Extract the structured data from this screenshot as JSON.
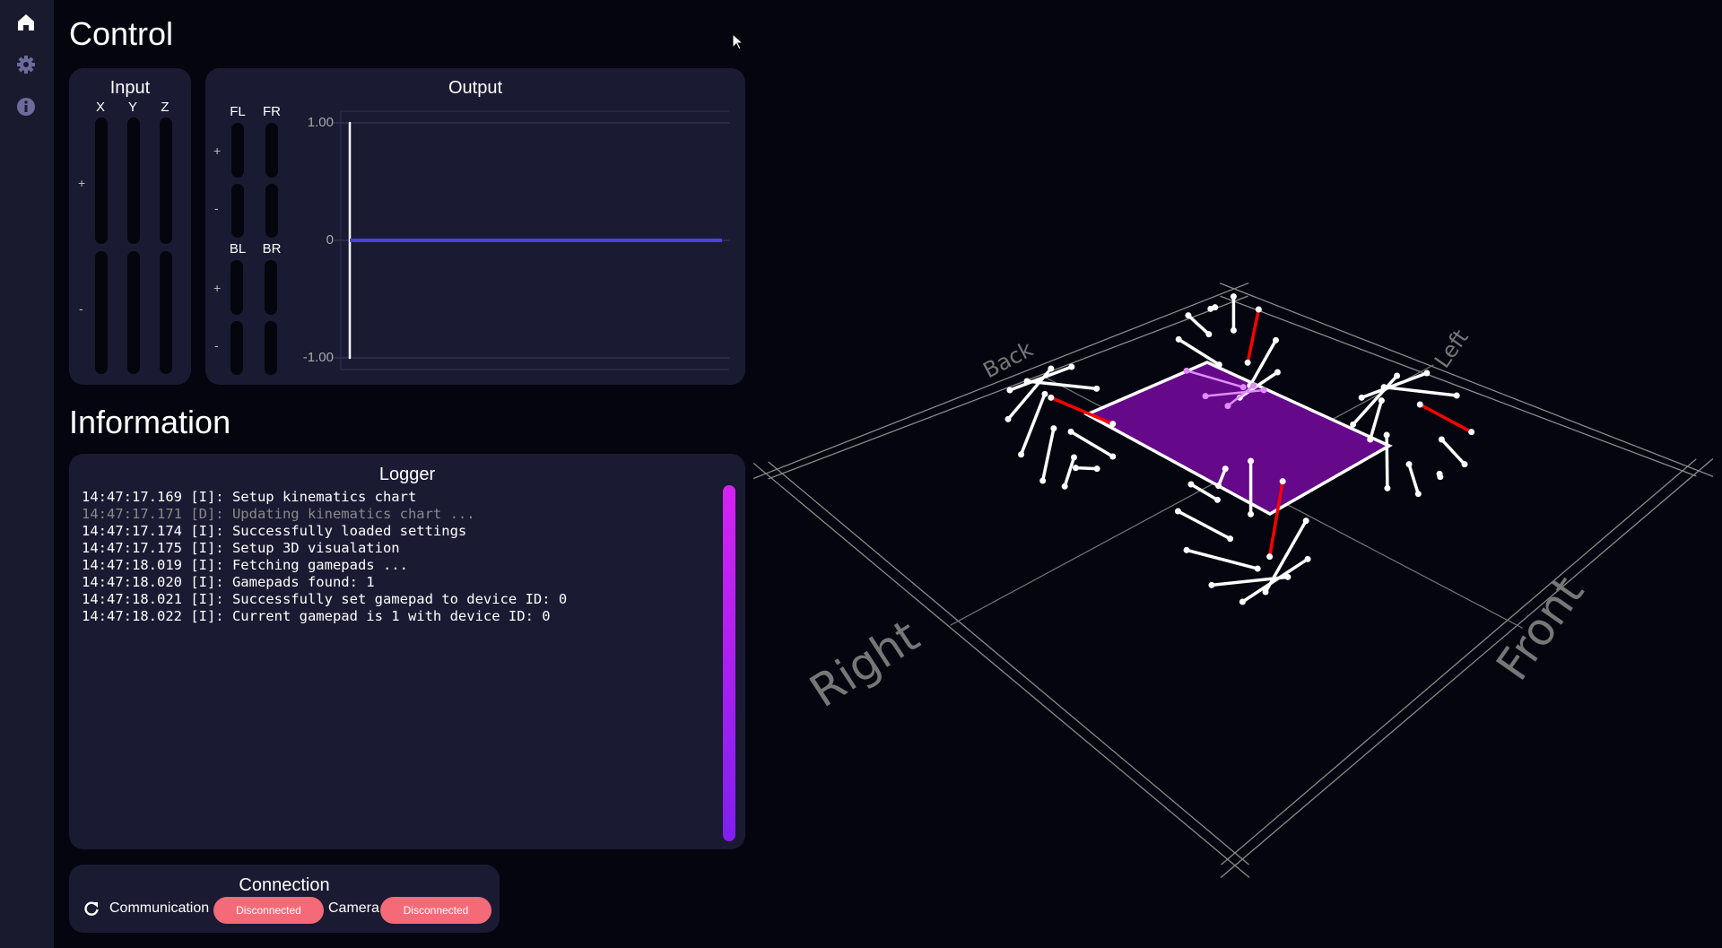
{
  "sidebar": {
    "items": [
      {
        "icon": "home-icon",
        "active": true
      },
      {
        "icon": "gear-icon",
        "active": false
      },
      {
        "icon": "info-icon",
        "active": false
      }
    ]
  },
  "control": {
    "title": "Control",
    "input": {
      "title": "Input",
      "axes": [
        "X",
        "Y",
        "Z"
      ],
      "plus": "+",
      "minus": "-"
    },
    "output": {
      "title": "Output",
      "wheels": [
        "FL",
        "FR",
        "BL",
        "BR"
      ],
      "plus": "+",
      "minus": "-"
    }
  },
  "chart_data": {
    "type": "line",
    "title": "",
    "ylim": [
      -1,
      1
    ],
    "yticks": [
      "1.00",
      "0",
      "-1.00"
    ],
    "grid": true,
    "series": [
      {
        "values": [
          0,
          0
        ],
        "color": "#4b3ff0"
      }
    ],
    "marker_line": {
      "color": "#ffffff",
      "range": [
        -1,
        1
      ]
    }
  },
  "information": {
    "title": "Information",
    "logger": {
      "title": "Logger",
      "lines": [
        {
          "text": "14:47:17.169 [I]: Setup kinematics chart",
          "level": "I"
        },
        {
          "text": "14:47:17.171 [D]: Updating kinematics chart ...",
          "level": "D"
        },
        {
          "text": "14:47:17.174 [I]: Successfully loaded settings",
          "level": "I"
        },
        {
          "text": "14:47:17.175 [I]: Setup 3D visualation",
          "level": "I"
        },
        {
          "text": "14:47:18.019 [I]: Fetching gamepads ...",
          "level": "I"
        },
        {
          "text": "14:47:18.020 [I]: Gamepads found: 1",
          "level": "I"
        },
        {
          "text": "14:47:18.021 [I]: Successfully set gamepad to device ID: 0",
          "level": "I"
        },
        {
          "text": "14:47:18.022 [I]: Current gamepad is 1 with device ID: 0",
          "level": "I"
        }
      ]
    }
  },
  "connection": {
    "title": "Connection",
    "communication_label": "Communication",
    "communication_status": "Disconnected",
    "camera_label": "Camera",
    "camera_status": "Disconnected",
    "status_color": "#f46a78"
  },
  "scene": {
    "labels": {
      "back": "Back",
      "left": "Left",
      "right": "Right",
      "front": "Front"
    },
    "body_color": "#65088a",
    "highlight_color": "#ff0000"
  }
}
